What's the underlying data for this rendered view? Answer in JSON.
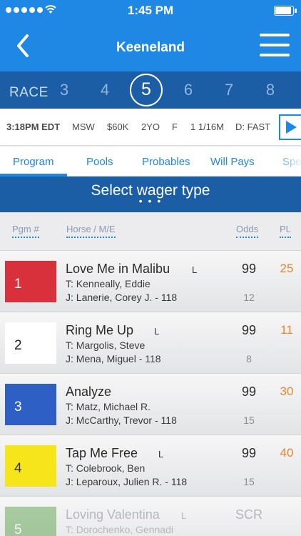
{
  "status_bar": {
    "time": "1:45 PM"
  },
  "nav": {
    "title": "Keeneland"
  },
  "race_selector": {
    "label": "RACE",
    "numbers": [
      "3",
      "4",
      "5",
      "6",
      "7",
      "8"
    ],
    "selected": "5"
  },
  "race_info": {
    "post_time": "3:18PM EDT",
    "type": "MSW",
    "purse": "$60K",
    "age": "2YO",
    "sex": "F",
    "distance": "1 1/16M",
    "surface": "D: FAST"
  },
  "tabs": [
    {
      "label": "Program",
      "active": true
    },
    {
      "label": "Pools"
    },
    {
      "label": "Probables"
    },
    {
      "label": "Will Pays"
    },
    {
      "label": "Spe"
    }
  ],
  "wager": {
    "title": "Select wager type",
    "dots": "• • •"
  },
  "columns": {
    "pgm": "Pgm #",
    "horse": "Horse / M/E",
    "odds": "Odds",
    "pl": "PL"
  },
  "runners": [
    {
      "pgm": "1",
      "color": "#d9313b",
      "text_color": "#ffffff",
      "horse": "Love Me in Malibu",
      "lasix": "L",
      "trainer": "T: Kenneally, Eddie",
      "jockey": "J: Lanerie, Corey J. - 118",
      "odds": "99",
      "ml": "12",
      "pl": "25"
    },
    {
      "pgm": "2",
      "color": "#ffffff",
      "text_color": "#222222",
      "horse": "Ring Me Up",
      "lasix": "L",
      "trainer": "T: Margolis, Steve",
      "jockey": "J: Mena, Miguel - 118",
      "odds": "99",
      "ml": "8",
      "pl": "11"
    },
    {
      "pgm": "3",
      "color": "#2d5fc4",
      "text_color": "#ffffff",
      "horse": "Analyze",
      "lasix": "",
      "trainer": "T: Matz, Michael R.",
      "jockey": "J: McCarthy, Trevor - 118",
      "odds": "99",
      "ml": "15",
      "pl": "30"
    },
    {
      "pgm": "4",
      "color": "#f6e51a",
      "text_color": "#333333",
      "horse": "Tap Me Free",
      "lasix": "L",
      "trainer": "T: Colebrook, Ben",
      "jockey": "J: Leparoux, Julien R. - 118",
      "odds": "99",
      "ml": "15",
      "pl": "40"
    },
    {
      "pgm": "5",
      "color": "#4f9a3b",
      "text_color": "#ffffff",
      "horse": "Loving Valentina",
      "lasix": "L",
      "trainer": "T: Dorochenko, Gennadi",
      "jockey": "",
      "odds": "SCR",
      "ml": "",
      "pl": "",
      "scratched": true
    }
  ]
}
